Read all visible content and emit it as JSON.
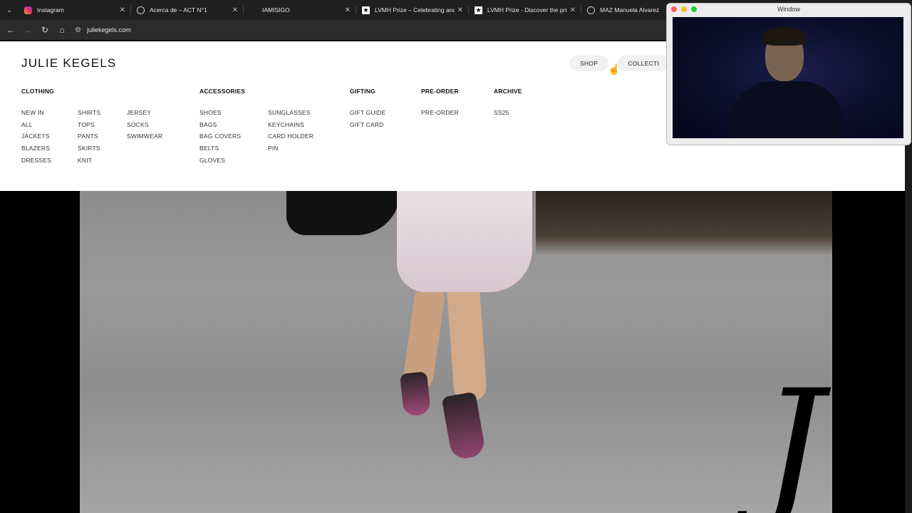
{
  "browser": {
    "tabs": [
      {
        "title": "Instagram",
        "favicon": "instagram-icon"
      },
      {
        "title": "Acerca de – ACT N°1",
        "favicon": "globe-icon"
      },
      {
        "title": "IAMISIGO",
        "favicon": "none"
      },
      {
        "title": "LVMH Prize – Celebrating and S",
        "favicon": "lvmh-star-icon"
      },
      {
        "title": "LVMH Prize - Discover the prize",
        "favicon": "lvmh-star-icon"
      },
      {
        "title": "MAZ Manuela Alvarez",
        "favicon": "globe-icon"
      }
    ],
    "url": "juliekegels.com"
  },
  "site": {
    "logo": "JULIE KEGELS",
    "nav": {
      "shop": "SHOP",
      "collections": "COLLECTI"
    },
    "menu": {
      "clothing": {
        "heading": "CLOTHING",
        "col1": [
          "NEW IN",
          "ALL",
          "JACKETS",
          "BLAZERS",
          "DRESSES"
        ],
        "col2": [
          "SHIRTS",
          "TOPS",
          "PANTS",
          "SKIRTS",
          "KNIT"
        ],
        "col3": [
          "JERSEY",
          "SOCKS",
          "SWIMWEAR"
        ]
      },
      "accessories": {
        "heading": "ACCESSORIES",
        "col1": [
          "SHOES",
          "BAGS",
          "BAG COVERS",
          "BELTS",
          "GLOVES"
        ],
        "col2": [
          "SUNGLASSES",
          "KEYCHAINS",
          "CARD HOLDER",
          "PIN"
        ]
      },
      "gifting": {
        "heading": "GIFTING",
        "items": [
          "GIFT GUIDE",
          "GIFT CARD"
        ]
      },
      "preorder": {
        "heading": "PRE-ORDER",
        "items": [
          "PRE-ORDER"
        ]
      },
      "archive": {
        "heading": "ARCHIVE",
        "items": [
          "SS25"
        ]
      }
    },
    "hero_mark": "J"
  },
  "video_window": {
    "title": "Window"
  }
}
